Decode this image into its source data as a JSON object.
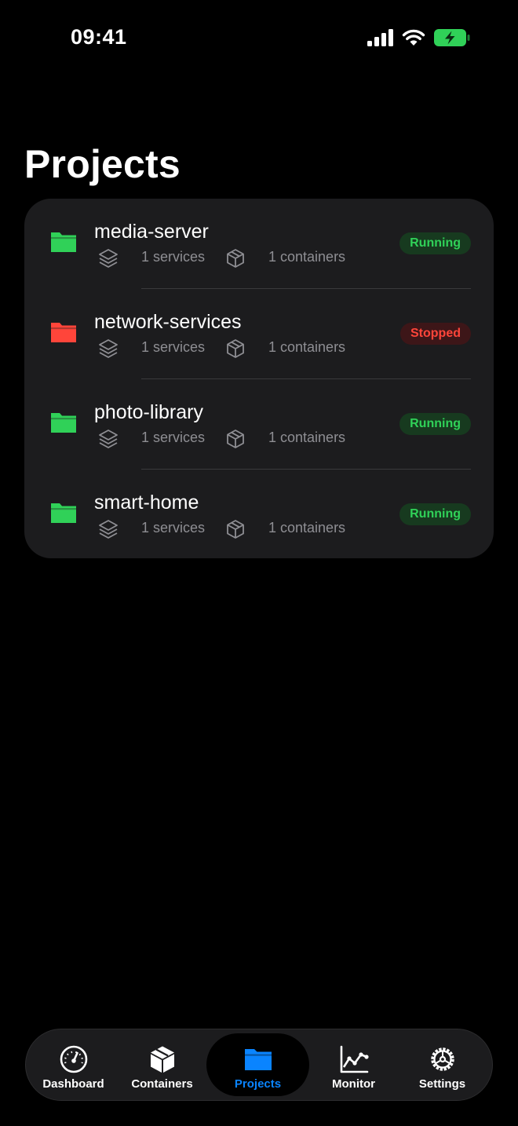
{
  "status_bar": {
    "time": "09:41"
  },
  "page": {
    "title": "Projects"
  },
  "colors": {
    "running": "#30d158",
    "stopped": "#ff453a",
    "accent": "#0a84ff",
    "card_bg": "#1c1c1e"
  },
  "projects": [
    {
      "name": "media-server",
      "services": "1 services",
      "containers": "1 containers",
      "status": "Running",
      "state": "running",
      "icon": "folder-icon"
    },
    {
      "name": "network-services",
      "services": "1 services",
      "containers": "1 containers",
      "status": "Stopped",
      "state": "stopped",
      "icon": "folder-icon"
    },
    {
      "name": "photo-library",
      "services": "1 services",
      "containers": "1 containers",
      "status": "Running",
      "state": "running",
      "icon": "folder-icon"
    },
    {
      "name": "smart-home",
      "services": "1 services",
      "containers": "1 containers",
      "status": "Running",
      "state": "running",
      "icon": "folder-icon"
    }
  ],
  "tab_bar": {
    "tabs": [
      {
        "label": "Dashboard",
        "icon": "gauge-icon",
        "active": false
      },
      {
        "label": "Containers",
        "icon": "cube-icon",
        "active": false
      },
      {
        "label": "Projects",
        "icon": "folder-icon",
        "active": true
      },
      {
        "label": "Monitor",
        "icon": "chart-line-icon",
        "active": false
      },
      {
        "label": "Settings",
        "icon": "gear-icon",
        "active": false
      }
    ]
  }
}
